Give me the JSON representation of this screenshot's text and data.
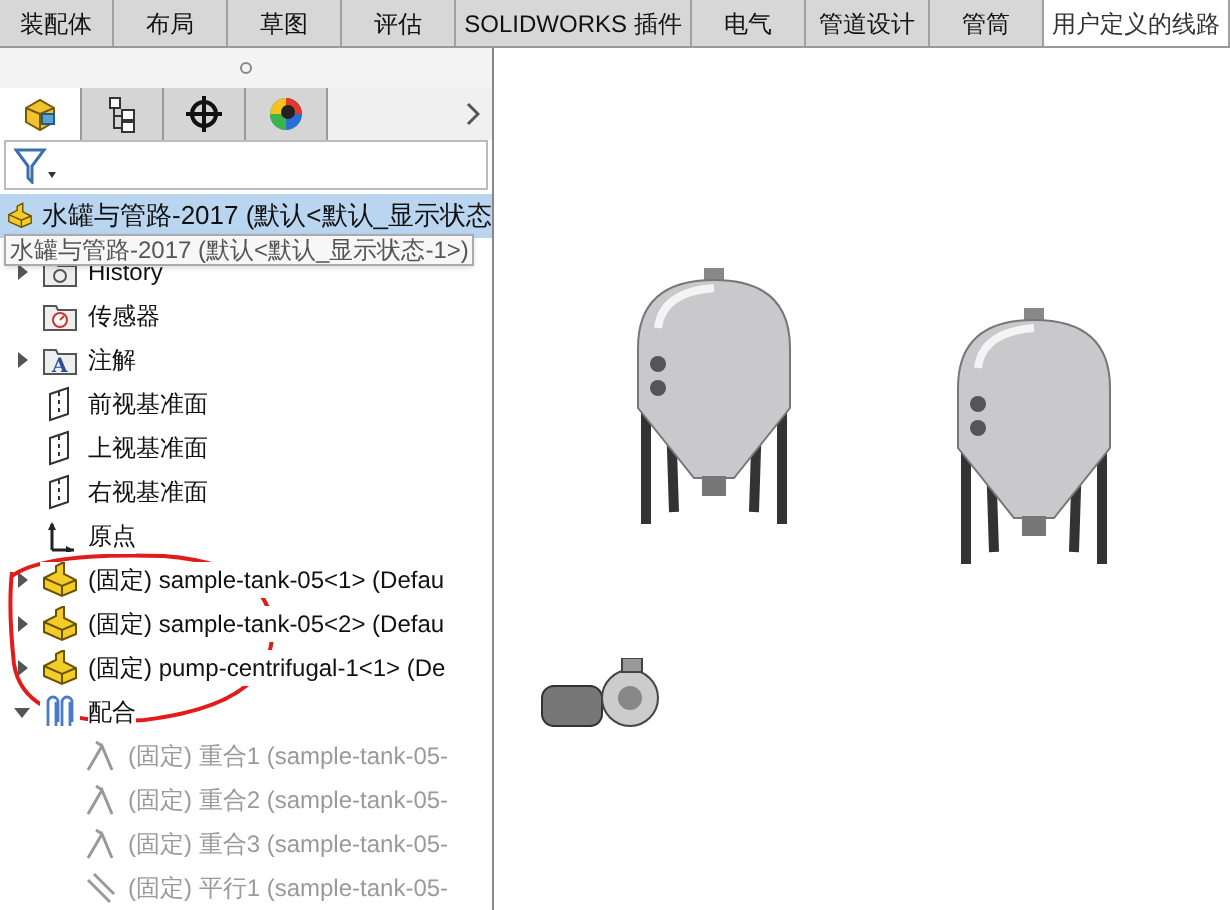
{
  "ribbon_tabs": [
    {
      "label": "装配体",
      "selected": false
    },
    {
      "label": "布局",
      "selected": false
    },
    {
      "label": "草图",
      "selected": false
    },
    {
      "label": "评估",
      "selected": false
    },
    {
      "label": "SOLIDWORKS 插件",
      "selected": false
    },
    {
      "label": "电气",
      "selected": false
    },
    {
      "label": "管道设计",
      "selected": false
    },
    {
      "label": "管筒",
      "selected": false
    },
    {
      "label": "用户定义的线路",
      "selected": true
    }
  ],
  "panel_tabs": [
    {
      "kind": "feature",
      "selected": true
    },
    {
      "kind": "property",
      "selected": false
    },
    {
      "kind": "config",
      "selected": false
    },
    {
      "kind": "display",
      "selected": false
    }
  ],
  "tree": {
    "root": {
      "label": "水罐与管路-2017  (默认<默认_显示状态",
      "selected": true
    },
    "tooltip": "水罐与管路-2017  (默认<默认_显示状态-1>)",
    "items": [
      {
        "kind": "history",
        "label": "History",
        "expanded": false,
        "dim": false
      },
      {
        "kind": "sensor",
        "label": "传感器",
        "dim": false
      },
      {
        "kind": "annotation",
        "label": "注解",
        "icon_glyph": "A",
        "expanded": false,
        "dim": false
      },
      {
        "kind": "plane",
        "label": "前视基准面",
        "dim": false
      },
      {
        "kind": "plane",
        "label": "上视基准面",
        "dim": false
      },
      {
        "kind": "plane",
        "label": "右视基准面",
        "dim": false
      },
      {
        "kind": "origin",
        "label": "原点",
        "dim": false
      },
      {
        "kind": "part",
        "label": "(固定) sample-tank-05<1> (Defau",
        "expanded": false,
        "dim": false
      },
      {
        "kind": "part",
        "label": "(固定) sample-tank-05<2> (Defau",
        "expanded": false,
        "dim": false
      },
      {
        "kind": "part",
        "label": "(固定) pump-centrifugal-1<1> (De",
        "expanded": false,
        "dim": false
      },
      {
        "kind": "mates",
        "label": "配合",
        "expanded": true,
        "dim": false,
        "children": [
          {
            "kind": "coincident",
            "label": "(固定) 重合1 (sample-tank-05-",
            "dim": true
          },
          {
            "kind": "coincident",
            "label": "(固定) 重合2 (sample-tank-05-",
            "dim": true
          },
          {
            "kind": "coincident",
            "label": "(固定) 重合3 (sample-tank-05-",
            "dim": true
          },
          {
            "kind": "parallel",
            "label": "(固定) 平行1 (sample-tank-05-",
            "dim": true
          }
        ]
      }
    ]
  }
}
